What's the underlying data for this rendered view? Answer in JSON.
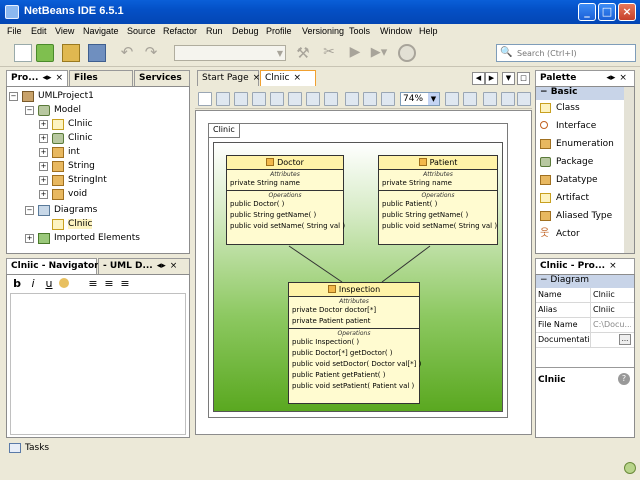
{
  "window": {
    "title": "NetBeans IDE 6.5.1"
  },
  "menu": [
    "File",
    "Edit",
    "View",
    "Navigate",
    "Source",
    "Refactor",
    "Run",
    "Debug",
    "Profile",
    "Versioning",
    "Tools",
    "Window",
    "Help"
  ],
  "search": {
    "placeholder": "Search (Ctrl+I)"
  },
  "left_tabs": {
    "projects": "Pro...",
    "files": "Files",
    "services": "Services"
  },
  "tree": {
    "project": "UMLProject1",
    "model": "Model",
    "items": [
      "Clniic",
      "Clinic",
      "int",
      "String",
      "StringInt",
      "void"
    ],
    "diagrams": "Diagrams",
    "diagram_item": "Clniic",
    "imported": "Imported Elements"
  },
  "navigator": {
    "tab1": "Clniic - Navigator",
    "tab2": "- UML D...",
    "tools": [
      "b",
      "i",
      "u"
    ]
  },
  "editor": {
    "tabs": [
      "Start Page",
      "Clniic"
    ],
    "zoom": "74%",
    "frame_label": "Clinic"
  },
  "classes": {
    "doctor": {
      "name": "Doctor",
      "attr_title": "Attributes",
      "attrs": [
        "private  String  name"
      ],
      "op_title": "Operations",
      "ops": [
        "public  Doctor(  )",
        "public  String  getName(  )",
        "public  void  setName( String val )"
      ]
    },
    "patient": {
      "name": "Patient",
      "attr_title": "Attributes",
      "attrs": [
        "private  String  name"
      ],
      "op_title": "Operations",
      "ops": [
        "public  Patient(  )",
        "public  String  getName(  )",
        "public  void  setName( String val )"
      ]
    },
    "inspection": {
      "name": "Inspection",
      "attr_title": "Attributes",
      "attrs": [
        "private  Doctor  doctor[*]",
        "private  Patient  patient"
      ],
      "op_title": "Operations",
      "ops": [
        "public  Inspection(  )",
        "public  Doctor[*]  getDoctor(  )",
        "public  void  setDoctor( Doctor val[*] )",
        "public  Patient  getPatient(  )",
        "public  void  setPatient( Patient val )"
      ]
    }
  },
  "palette": {
    "title": "Palette",
    "section": "Basic",
    "items": [
      "Class",
      "Interface",
      "Enumeration",
      "Package",
      "Datatype",
      "Artifact",
      "Aliased Type",
      "Actor"
    ]
  },
  "properties": {
    "title": "Clniic - Pro...",
    "section": "Diagram",
    "rows": [
      {
        "k": "Name",
        "v": "Clniic"
      },
      {
        "k": "Alias",
        "v": "Clniic"
      },
      {
        "k": "File Name",
        "v": "C:\\Docu..."
      },
      {
        "k": "Documentatio",
        "v": ""
      }
    ],
    "footer": "Clniic"
  },
  "status": {
    "tasks": "Tasks"
  },
  "colors": {
    "titlebar": "#0450c6",
    "diagram_bottom": "#5aa820",
    "class_head": "#fff3a8"
  }
}
